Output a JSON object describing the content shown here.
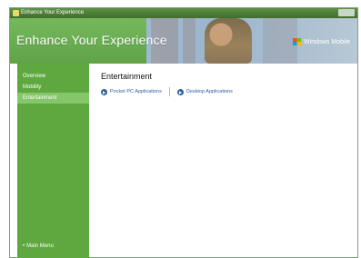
{
  "window": {
    "title": "Enhance Your Experience"
  },
  "banner": {
    "title": "Enhance Your Experience",
    "brand": "Windows Mobile"
  },
  "sidebar": {
    "items": [
      {
        "label": "Overview"
      },
      {
        "label": "Mobility"
      },
      {
        "label": "Entertainment"
      }
    ],
    "footer_label": "Main Menu"
  },
  "main": {
    "heading": "Entertainment",
    "links": [
      {
        "label": "Pocket PC Applications"
      },
      {
        "label": "Desktop Applications"
      }
    ]
  }
}
